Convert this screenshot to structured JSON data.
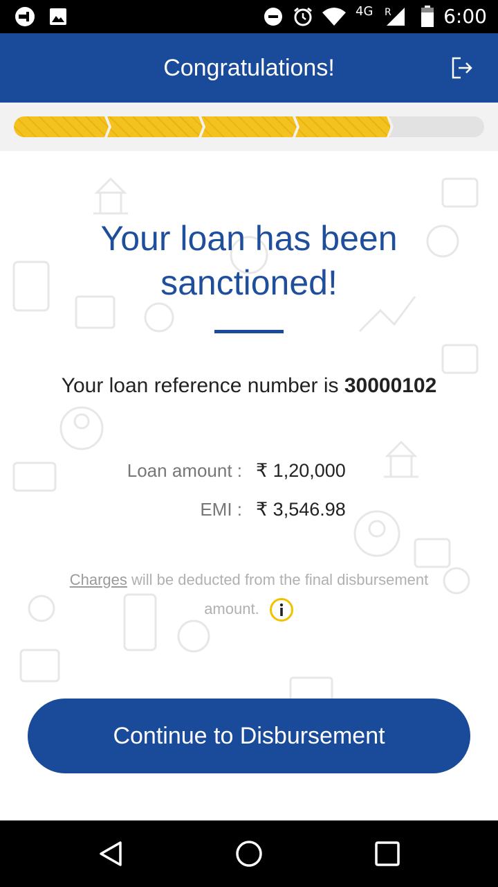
{
  "status_bar": {
    "network": "4G",
    "roaming": "R",
    "time": "6:00",
    "icons": [
      "app-notification-icon",
      "image-notification-icon",
      "do-not-disturb-icon",
      "alarm-icon",
      "wifi-icon",
      "signal-icon",
      "battery-icon"
    ]
  },
  "app_bar": {
    "title": "Congratulations!",
    "action_icon": "logout-icon"
  },
  "progress": {
    "completed_steps": 4,
    "total_steps": 5,
    "fill_color": "#f4c21f",
    "track_color": "#e2e2e2"
  },
  "main": {
    "headline": "Your loan has been sanctioned!",
    "reference_prefix": "Your loan reference number is",
    "reference_number": "30000102",
    "loan_amount_label": "Loan amount :",
    "loan_amount_value": "₹ 1,20,000",
    "emi_label": "EMI :",
    "emi_value": "₹ 3,546.98",
    "charges_link": "Charges",
    "charges_text": "will be deducted from the final disbursement amount.",
    "cta_label": "Continue to Disbursement"
  },
  "colors": {
    "brand": "#1a4a9a",
    "headline": "#1e4e9c",
    "progress": "#f4c21f",
    "info": "#f2c200"
  },
  "nav_bar": {
    "icons": [
      "back-icon",
      "home-icon",
      "recents-icon"
    ]
  }
}
